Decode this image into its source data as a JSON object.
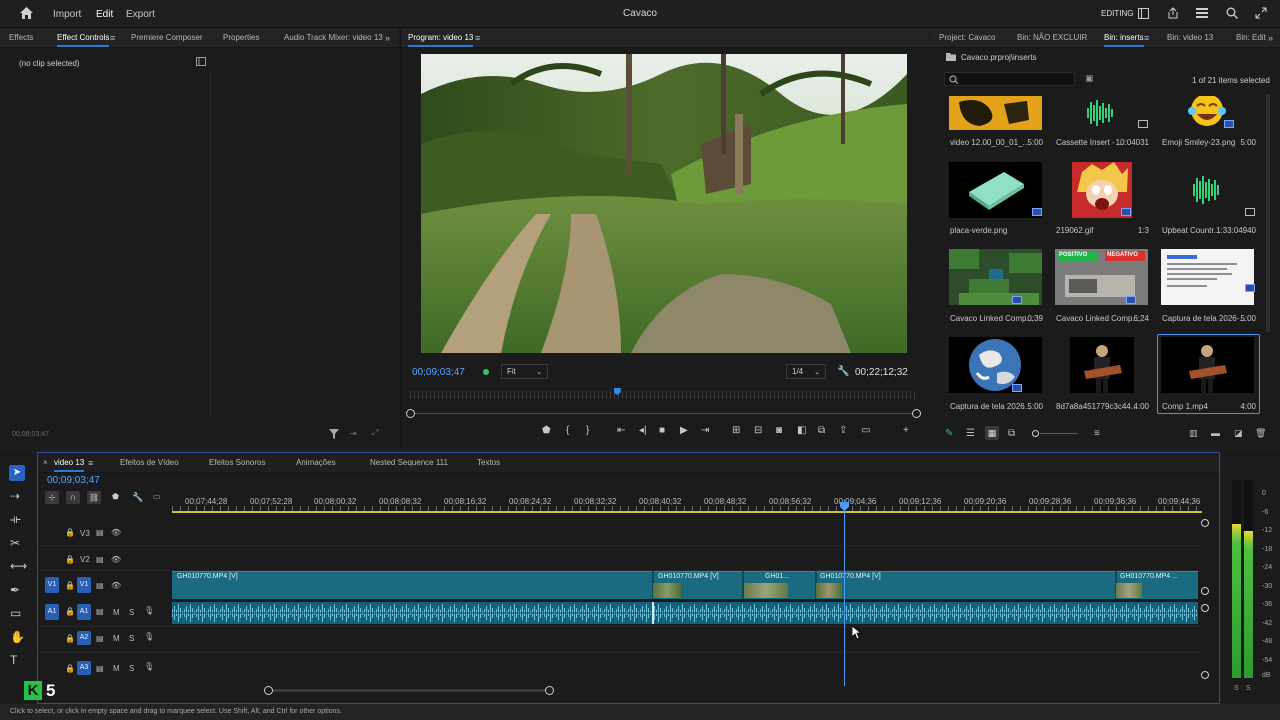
{
  "app": {
    "title": "Cavaco",
    "menus": [
      "Import",
      "Edit",
      "Export"
    ],
    "active_menu": "Edit",
    "workspace_label": "EDITING"
  },
  "left_panel": {
    "tabs": [
      "Effects",
      "Effect Controls",
      "Premiere Composer",
      "Properties",
      "Audio Track Mixer: video 13"
    ],
    "active_tab": "Effect Controls",
    "no_clip_text": "(no clip selected)",
    "footer_timecode": "00;09;03;47"
  },
  "program": {
    "tab_label": "Program: video 13",
    "current_timecode": "00;09;03;47",
    "fit_label": "Fit",
    "resolution_label": "1/4",
    "duration_timecode": "00;22;12;32",
    "playhead_fraction": 0.407
  },
  "project": {
    "tabs": [
      "Project: Cavaco",
      "Bin: NÃO EXCLUIR",
      "Bin: inserts",
      "Bin: video 13",
      "Bin: Edit"
    ],
    "active_tab": "Bin: inserts",
    "breadcrumb": "Cavaco.prproj\\inserts",
    "selection_count": "1 of 21 items selected",
    "items": [
      {
        "label": "video 12.00_00_01_...",
        "duration": "5:00",
        "kind": "yellow"
      },
      {
        "label": "Cassette Insert - ...",
        "duration": "10:04031",
        "kind": "audio"
      },
      {
        "label": "Emoji Smiley-23.png",
        "duration": "5:00",
        "kind": "emoji"
      },
      {
        "label": "placa-verde.png",
        "duration": "",
        "kind": "plate"
      },
      {
        "label": "219062.gif",
        "duration": "1:3",
        "kind": "anime"
      },
      {
        "label": "Upbeat Countr...",
        "duration": "1:33:04940",
        "kind": "audio"
      },
      {
        "label": "Cavaco Linked Comp...",
        "duration": "0;39",
        "kind": "minecraft"
      },
      {
        "label": "Cavaco Linked Comp...",
        "duration": "6;24",
        "kind": "positivo"
      },
      {
        "label": "Captura de tela 2026-...",
        "duration": "5:00",
        "kind": "doc"
      },
      {
        "label": "Captura de tela 2026...",
        "duration": "5:00",
        "kind": "earth"
      },
      {
        "label": "8d7a8a451779c3c44...",
        "duration": "4:00",
        "kind": "guitar"
      },
      {
        "label": "Comp 1.mp4",
        "duration": "4:00",
        "kind": "guitar",
        "selected": true
      }
    ]
  },
  "timeline": {
    "tabs": [
      "video 13",
      "Efeitos de Vídeo",
      "Efeitos Sonoros",
      "Animações",
      "Nested Sequence 111",
      "Textos"
    ],
    "active_tab": "video 13",
    "current_timecode": "00;09;03;47",
    "ruler": [
      "00;07;44;28",
      "00;07;52;28",
      "00;08;00;32",
      "00;08;08;32",
      "00;08;16;32",
      "00;08;24;32",
      "00;08;32;32",
      "00;08;40;32",
      "00;08;48;32",
      "00;08;56;32",
      "00;09;04;36",
      "00;09;12;36",
      "00;09;20;36",
      "00;09;28;36",
      "00;09;36;36",
      "00;09;44;36"
    ],
    "tracks": {
      "video": [
        "V3",
        "V2",
        "V1"
      ],
      "audio": [
        "A1",
        "A2",
        "A3"
      ],
      "mute": "M",
      "solo": "S",
      "source_patch_video": "V1",
      "source_patch_audio": "A1"
    },
    "clips": [
      {
        "label": "GH010770.MP4 [V]"
      },
      {
        "label": "GH010770.MP4 [V]"
      },
      {
        "label": "GH01..."
      },
      {
        "label": "GH010770.MP4 [V]"
      },
      {
        "label": "GH010770.MP4 ..."
      }
    ]
  },
  "meters": {
    "scale": [
      "0",
      "-6",
      "-12",
      "-18",
      "-24",
      "-30",
      "-36",
      "-42",
      "-48",
      "-54",
      "dB"
    ],
    "footer": [
      "S",
      "S"
    ],
    "left_level": 0.78,
    "right_level": 0.74
  },
  "status_text": "Click to select, or click in empty space and drag to marquee select. Use Shift, Alt, and Ctrl for other options.",
  "watermark": "K5"
}
